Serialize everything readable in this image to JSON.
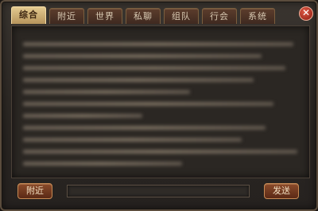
{
  "tabs": [
    "综合",
    "附近",
    "世界",
    "私聊",
    "组队",
    "行会",
    "系统"
  ],
  "close_glyph": "✕",
  "bottom": {
    "channel_label": "附近",
    "send_label": "发送",
    "input_value": ""
  },
  "colors": {
    "active_tab": "#d9bd84",
    "tab": "#4b3226",
    "button": "#6f381d",
    "panel": "#2b2723"
  }
}
